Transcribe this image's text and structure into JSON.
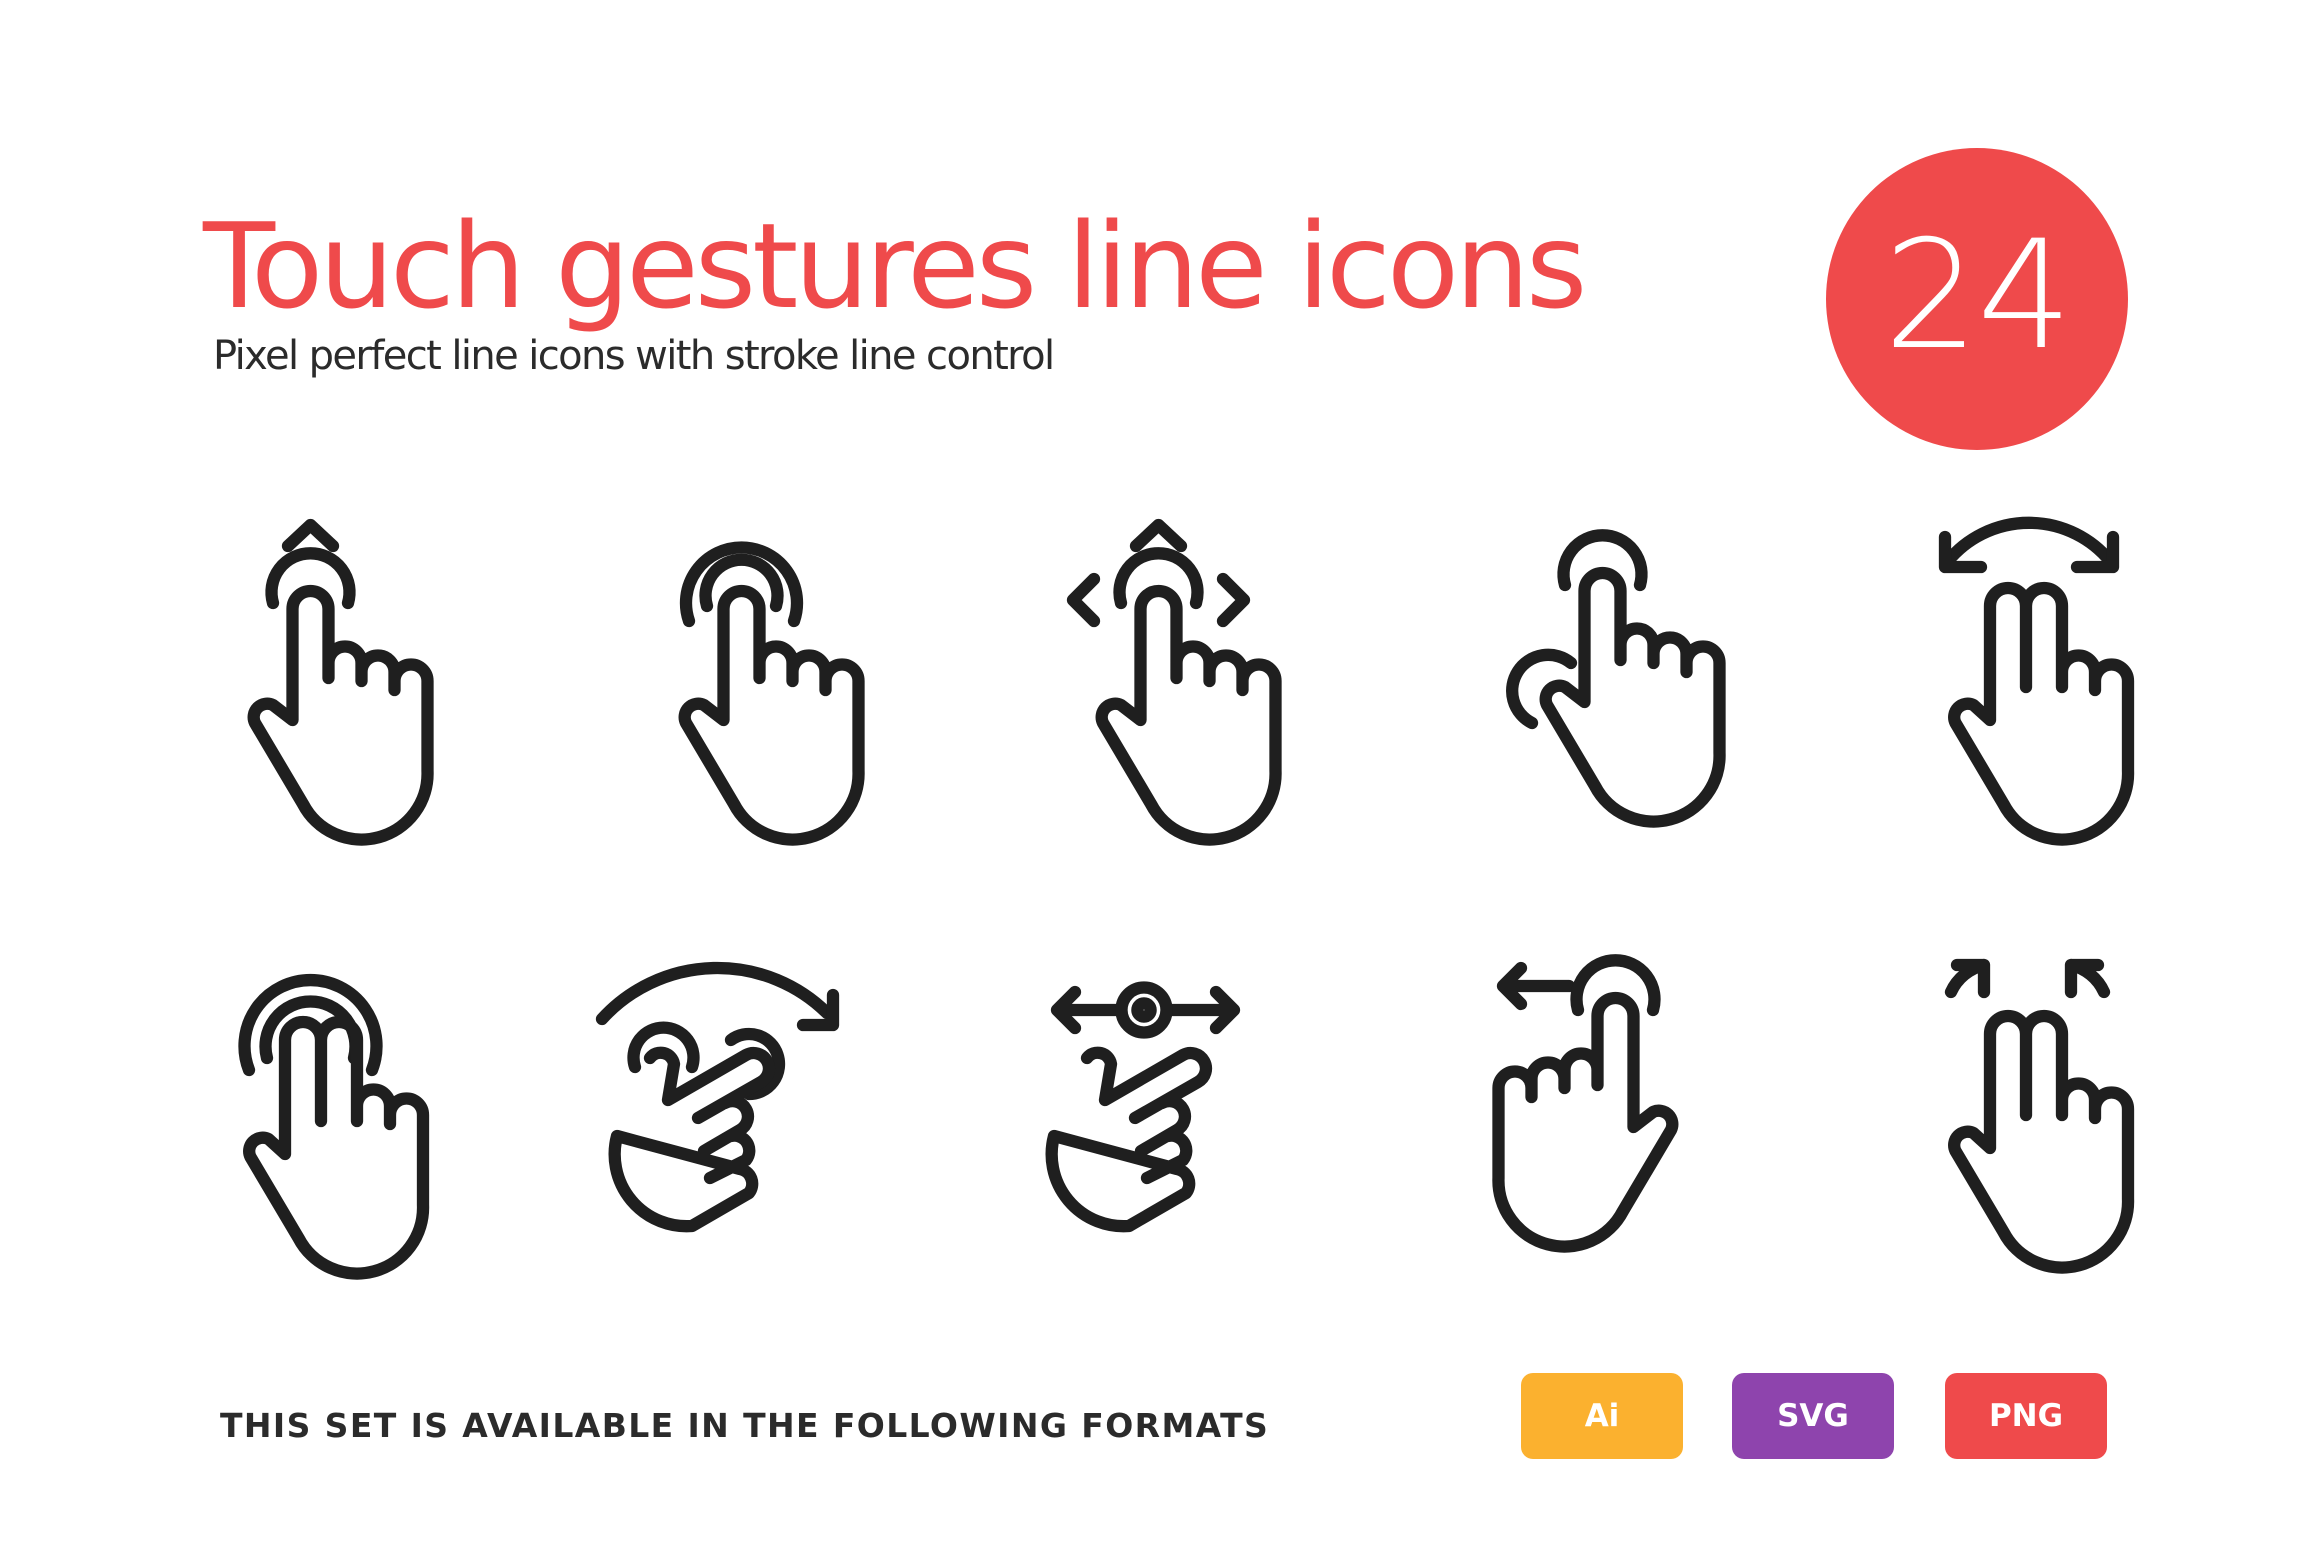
{
  "colors": {
    "accent": "#ef4a4b",
    "text_dark": "#2b2b2b",
    "icon_stroke": "#1f1f1f",
    "badge_text": "#ffffff"
  },
  "header": {
    "title": "Touch gestures line icons",
    "subtitle": "Pixel perfect line icons with stroke line control",
    "icon_count": "24"
  },
  "icons": [
    {
      "name": "swipe-up-gesture-icon",
      "label": "Tap and swipe up"
    },
    {
      "name": "double-tap-gesture-icon",
      "label": "Double tap"
    },
    {
      "name": "drag-all-directions-gesture-icon",
      "label": "Tap and drag in all directions"
    },
    {
      "name": "tap-and-hold-rotate-gesture-icon",
      "label": "Tap with circular motion"
    },
    {
      "name": "two-finger-rotate-gesture-icon",
      "label": "Two finger rotate"
    },
    {
      "name": "two-finger-double-tap-gesture-icon",
      "label": "Two finger double tap"
    },
    {
      "name": "two-finger-rotate-clockwise-gesture-icon",
      "label": "Two finger rotate clockwise"
    },
    {
      "name": "horizontal-scroll-gesture-icon",
      "label": "Horizontal scroll"
    },
    {
      "name": "swipe-left-gesture-icon",
      "label": "Swipe left"
    },
    {
      "name": "two-finger-spread-gesture-icon",
      "label": "Two finger spread"
    }
  ],
  "footer": {
    "formats_label": "THIS SET IS AVAILABLE IN THE FOLLOWING FORMATS",
    "formats": [
      {
        "label": "Ai",
        "color": "#fbb12f"
      },
      {
        "label": "SVG",
        "color": "#8e44ad"
      },
      {
        "label": "PNG",
        "color": "#ef4a4b"
      }
    ]
  }
}
